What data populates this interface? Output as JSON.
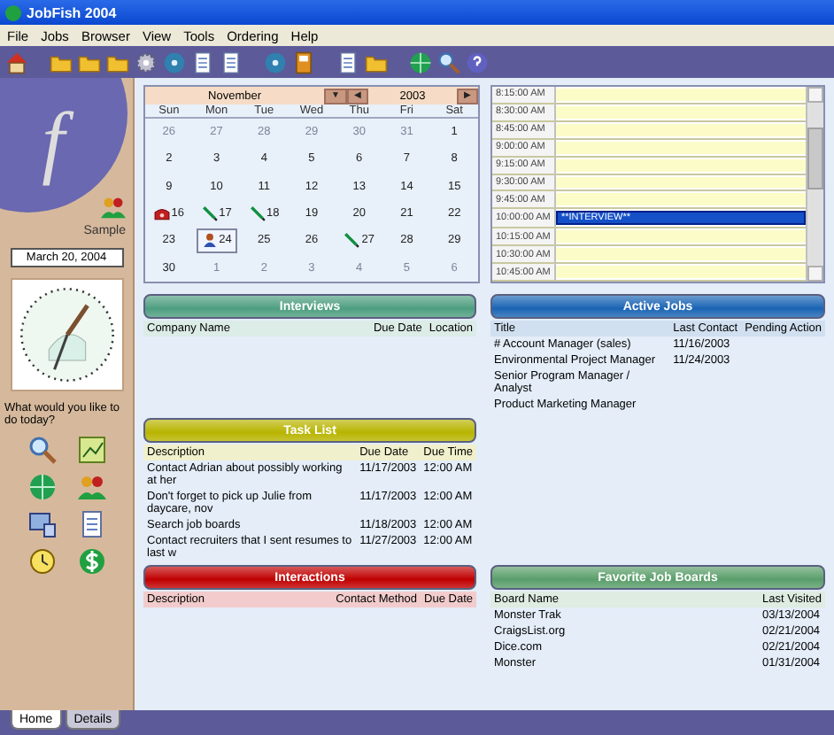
{
  "window": {
    "title": "JobFish 2004"
  },
  "menu": [
    "File",
    "Jobs",
    "Browser",
    "View",
    "Tools",
    "Ordering",
    "Help"
  ],
  "sidebar": {
    "logo": "f",
    "profile": "Sample",
    "date": "March 20, 2004",
    "prompt": "What would you like to do today?"
  },
  "calendar": {
    "month": "November",
    "month_button": "▼",
    "prev_button": "◀",
    "year": "2003",
    "next_button": "▶",
    "weekdays": [
      "Sun",
      "Mon",
      "Tue",
      "Wed",
      "Thu",
      "Fri",
      "Sat"
    ],
    "days": [
      {
        "day": "26",
        "muted": true,
        "selected": false
      },
      {
        "day": "27",
        "muted": true,
        "selected": false
      },
      {
        "day": "28",
        "muted": true,
        "selected": false
      },
      {
        "day": "29",
        "muted": true,
        "selected": false
      },
      {
        "day": "30",
        "muted": true,
        "selected": false
      },
      {
        "day": "31",
        "muted": true,
        "selected": false
      },
      {
        "day": "1",
        "muted": false,
        "selected": false
      },
      {
        "day": "2",
        "muted": false,
        "selected": false
      },
      {
        "day": "3",
        "muted": false,
        "selected": false
      },
      {
        "day": "4",
        "muted": false,
        "selected": false
      },
      {
        "day": "5",
        "muted": false,
        "selected": false
      },
      {
        "day": "6",
        "muted": false,
        "selected": false
      },
      {
        "day": "7",
        "muted": false,
        "selected": false
      },
      {
        "day": "8",
        "muted": false,
        "selected": false
      },
      {
        "day": "9",
        "muted": false,
        "selected": false
      },
      {
        "day": "10",
        "muted": false,
        "selected": false
      },
      {
        "day": "11",
        "muted": false,
        "selected": false
      },
      {
        "day": "12",
        "muted": false,
        "selected": false
      },
      {
        "day": "13",
        "muted": false,
        "selected": false
      },
      {
        "day": "14",
        "muted": false,
        "selected": false
      },
      {
        "day": "15",
        "muted": false,
        "selected": false
      },
      {
        "day": "16",
        "muted": false,
        "selected": false,
        "kind": "phone"
      },
      {
        "day": "17",
        "muted": false,
        "selected": false,
        "kind": "pen"
      },
      {
        "day": "18",
        "muted": false,
        "selected": false,
        "kind": "pen"
      },
      {
        "day": "19",
        "muted": false,
        "selected": false
      },
      {
        "day": "20",
        "muted": false,
        "selected": false
      },
      {
        "day": "21",
        "muted": false,
        "selected": false
      },
      {
        "day": "22",
        "muted": false,
        "selected": false
      },
      {
        "day": "23",
        "muted": false,
        "selected": false
      },
      {
        "day": "24",
        "muted": false,
        "selected": true,
        "kind": "person"
      },
      {
        "day": "25",
        "muted": false,
        "selected": false
      },
      {
        "day": "26",
        "muted": false,
        "selected": false
      },
      {
        "day": "27",
        "muted": false,
        "selected": false,
        "kind": "pen"
      },
      {
        "day": "28",
        "muted": false,
        "selected": false
      },
      {
        "day": "29",
        "muted": false,
        "selected": false
      },
      {
        "day": "30",
        "muted": false,
        "selected": false
      },
      {
        "day": "1",
        "muted": true,
        "selected": false
      },
      {
        "day": "2",
        "muted": true,
        "selected": false
      },
      {
        "day": "3",
        "muted": true,
        "selected": false
      },
      {
        "day": "4",
        "muted": true,
        "selected": false
      },
      {
        "day": "5",
        "muted": true,
        "selected": false
      },
      {
        "day": "6",
        "muted": true,
        "selected": false
      }
    ]
  },
  "schedule": [
    {
      "time": "8:15:00 AM",
      "selected": false
    },
    {
      "time": "8:30:00 AM",
      "selected": false
    },
    {
      "time": "8:45:00 AM",
      "selected": false
    },
    {
      "time": "9:00:00 AM",
      "selected": false
    },
    {
      "time": "9:15:00 AM",
      "selected": false
    },
    {
      "time": "9:30:00 AM",
      "selected": false
    },
    {
      "time": "9:45:00 AM",
      "selected": false
    },
    {
      "time": "10:00:00 AM",
      "entry": "**INTERVIEW**",
      "selected": true
    },
    {
      "time": "10:15:00 AM",
      "selected": false
    },
    {
      "time": "10:30:00 AM",
      "selected": false
    },
    {
      "time": "10:45:00 AM",
      "selected": false
    }
  ],
  "panels_left": [
    {
      "title": "Interviews",
      "color": "#4e9e80",
      "columns": [
        "Company Name",
        "Due Date",
        "Location"
      ]
    },
    {
      "title": "Task List",
      "color": "#b8b400",
      "columns": [
        "Description",
        "Due Date",
        "Due Time"
      ],
      "rows": [
        [
          "Contact Adrian about possibly working at her",
          "11/17/2003",
          "12:00 AM"
        ],
        [
          "Don't forget to pick up Julie from daycare, nov",
          "11/17/2003",
          "12:00 AM"
        ],
        [
          "Search job boards",
          "11/18/2003",
          "12:00 AM"
        ],
        [
          "Contact recruiters that I sent resumes to last w",
          "11/27/2003",
          "12:00 AM"
        ]
      ]
    },
    {
      "title": "Interactions",
      "color": "#c00000",
      "columns": [
        "Description",
        "Contact Method",
        "Due Date"
      ]
    }
  ],
  "panels_right": [
    {
      "title": "Active Jobs",
      "color": "#1a64b4",
      "columns": [
        "Title",
        "Last Contact",
        "Pending Action"
      ],
      "rows": [
        [
          "# Account Manager (sales)",
          "11/16/2003"
        ],
        [
          "Environmental Project Manager",
          "11/24/2003"
        ],
        [
          "Senior Program Manager / Analyst"
        ],
        [
          "Product Marketing Manager"
        ]
      ]
    },
    {
      "title": "Favorite Job Boards",
      "color": "#5a9e6a",
      "columns": [
        "Board Name",
        "Last Visited"
      ],
      "rows": [
        [
          "Monster Trak",
          "03/13/2004"
        ],
        [
          "CraigsList.org",
          "02/21/2004"
        ],
        [
          "Dice.com",
          "02/21/2004"
        ],
        [
          "Monster",
          "01/31/2004"
        ]
      ]
    }
  ],
  "tabs": [
    {
      "label": "Home",
      "selected": true
    },
    {
      "label": "Details",
      "selected": false
    }
  ]
}
